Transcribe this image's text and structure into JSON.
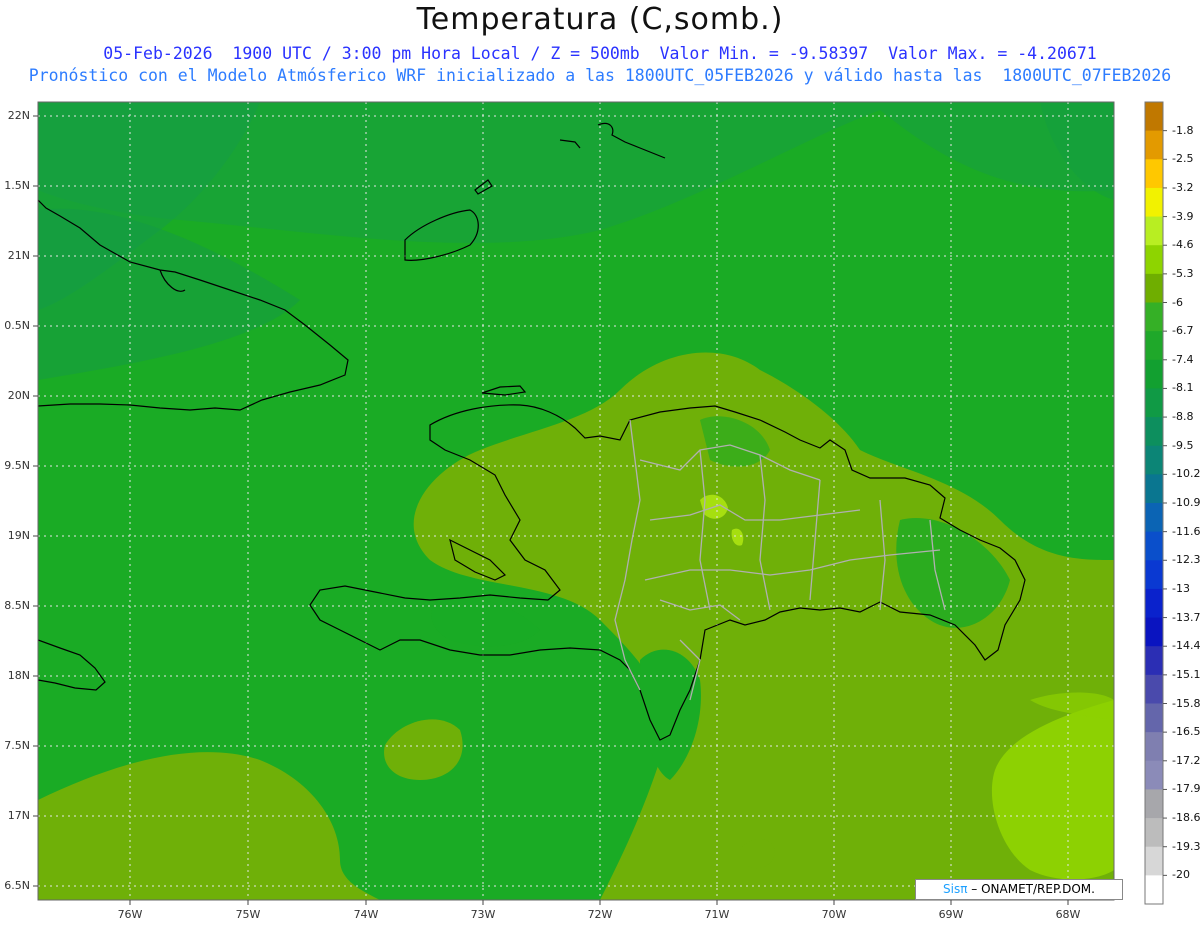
{
  "title": "Temperatura (C,somb.)",
  "subtitle_line1": "05-Feb-2026  1900 UTC / 3:00 pm Hora Local / Z = 500mb  Valor Min. = -9.58397  Valor Max. = -4.20671",
  "subtitle_line2": "Pronóstico con el Modelo Atmósferico WRF inicializado a las 1800UTC_05FEB2026 y válido hasta las  1800UTC_07FEB2026",
  "lat_labels": [
    "22N",
    "1.5N",
    "21N",
    "0.5N",
    "20N",
    "9.5N",
    "19N",
    "8.5N",
    "18N",
    "7.5N",
    "17N",
    "6.5N"
  ],
  "lon_labels": [
    "76W",
    "75W",
    "74W",
    "73W",
    "72W",
    "71W",
    "70W",
    "69W",
    "68W"
  ],
  "colorbar": {
    "labels": [
      "-1.8",
      "-2.5",
      "-3.2",
      "-3.9",
      "-4.6",
      "-5.3",
      "-6",
      "-6.7",
      "-7.4",
      "-8.1",
      "-8.8",
      "-9.5",
      "-10.2",
      "-10.9",
      "-11.6",
      "-12.3",
      "-13",
      "-13.7",
      "-14.4",
      "-15.1",
      "-15.8",
      "-16.5",
      "-17.2",
      "-17.9",
      "-18.6",
      "-19.3",
      "-20"
    ],
    "colors": [
      "#c07800",
      "#e39a00",
      "#ffc800",
      "#f2f200",
      "#b8ee22",
      "#8ed400",
      "#6fae00",
      "#35b026",
      "#1fa82a",
      "#12a030",
      "#109a45",
      "#0d8f5e",
      "#0c8576",
      "#0a7690",
      "#0b64b4",
      "#0a4fcb",
      "#0a39d2",
      "#0a22cc",
      "#0a14c0",
      "#2b2eb4",
      "#4a4aac",
      "#6466ab",
      "#7f7fb0",
      "#8b8bb8",
      "#a7a7ab",
      "#bcbcbc",
      "#d7d7d7",
      "#ffffff"
    ]
  },
  "credit": {
    "logo": "Sisπ",
    "text": "–  ONAMET/REP.DOM."
  },
  "colors": {
    "sea_green": "#1aab25",
    "warm_green": "#6fb008",
    "cool_green": "#17a03a",
    "light_lime": "#8dd102"
  }
}
